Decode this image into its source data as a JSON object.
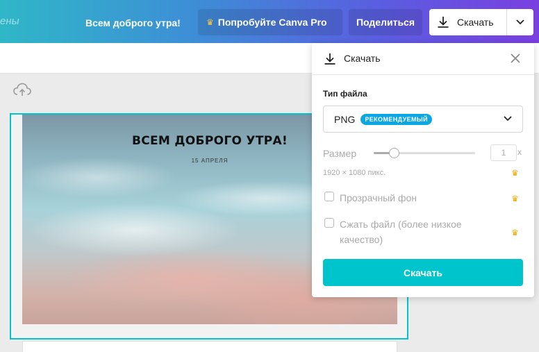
{
  "topbar": {
    "faded_text": "ены",
    "doc_title": "Всем доброго утра!",
    "try_pro_label": "Попробуйте Canva Pro",
    "share_label": "Поделиться",
    "download_label": "Скачать"
  },
  "design": {
    "title": "ВСЕМ ДОБРОГО УТРА!",
    "date": "15 АПРЕЛЯ"
  },
  "download_panel": {
    "title": "Скачать",
    "file_type_label": "Тип файла",
    "file_type_value": "PNG",
    "recommended_badge": "РЕКОМЕНДУЕМЫЙ",
    "size_label": "Размер",
    "size_value": "1",
    "size_suffix": "x",
    "size_slider_fraction": 0.2,
    "dimensions": "1920 × 1080 пикс.",
    "transparent_bg_label": "Прозрачный фон",
    "compress_label_line1": "Сжать файл (более низкое",
    "compress_label_line2": "качество)",
    "download_button": "Скачать"
  },
  "colors": {
    "accent": "#00c4cc",
    "badge": "#0aa7e4",
    "crown": "#f0a800"
  }
}
